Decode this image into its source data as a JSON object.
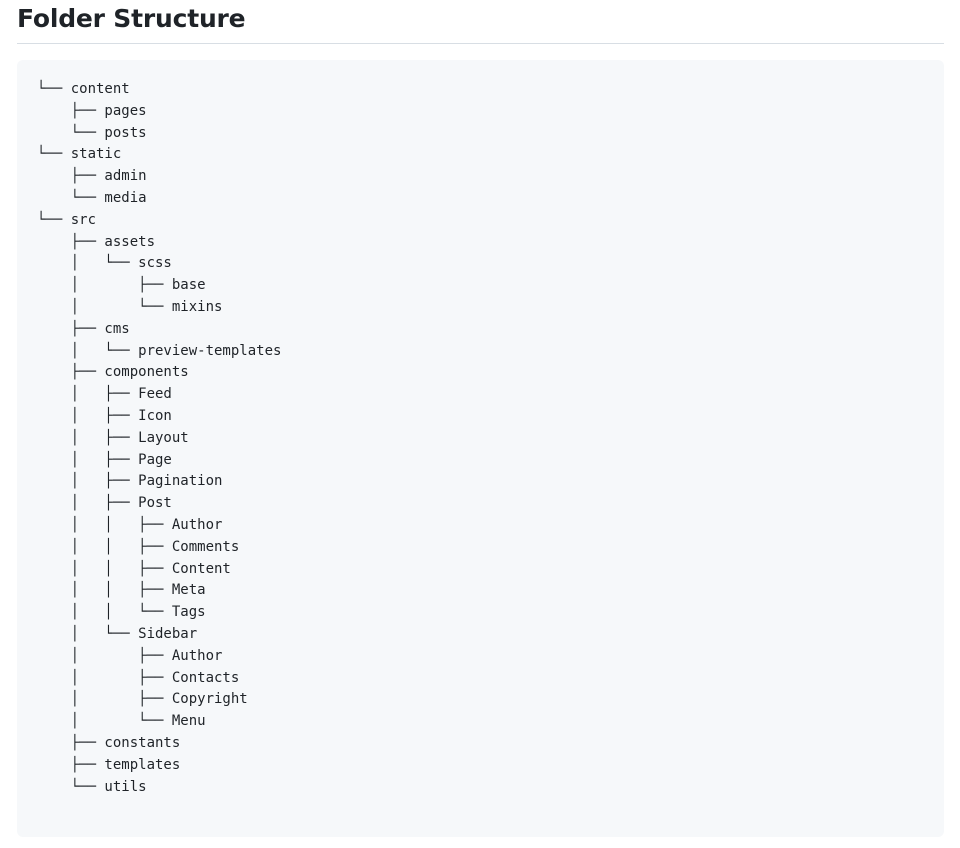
{
  "title": "Folder Structure",
  "tree_lines": [
    "└── content",
    "    ├── pages",
    "    └── posts",
    "└── static",
    "    ├── admin",
    "    └── media",
    "└── src",
    "    ├── assets",
    "    │   └── scss",
    "    │       ├── base",
    "    │       └── mixins",
    "    ├── cms",
    "    │   └── preview-templates",
    "    ├── components",
    "    │   ├── Feed",
    "    │   ├── Icon",
    "    │   ├── Layout",
    "    │   ├── Page",
    "    │   ├── Pagination",
    "    │   ├── Post",
    "    │   │   ├── Author",
    "    │   │   ├── Comments",
    "    │   │   ├── Content",
    "    │   │   ├── Meta",
    "    │   │   └── Tags",
    "    │   └── Sidebar",
    "    │       ├── Author",
    "    │       ├── Contacts",
    "    │       ├── Copyright",
    "    │       └── Menu",
    "    ├── constants",
    "    ├── templates",
    "    └── utils"
  ]
}
